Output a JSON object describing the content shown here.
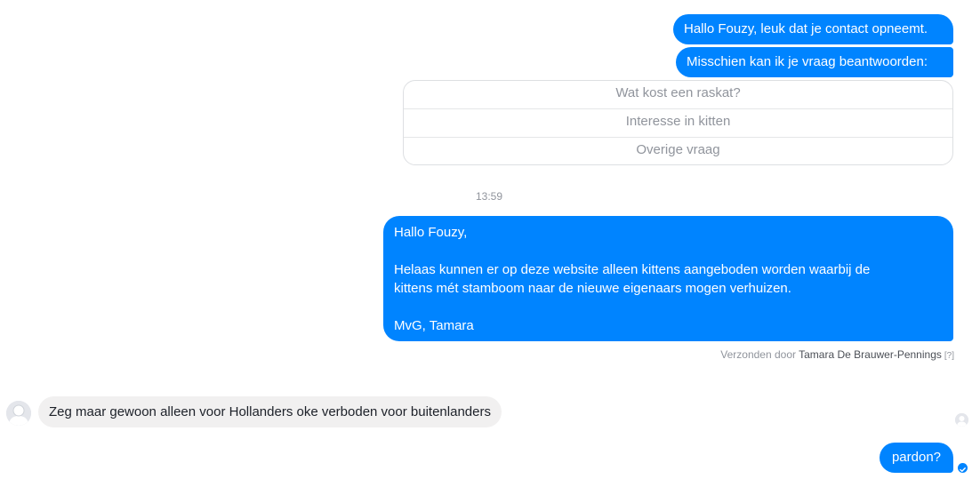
{
  "messages": {
    "greeting": "Hallo Fouzy, leuk dat je contact opneemt.",
    "question_intro": "Misschien kan ik je vraag beantwoorden:",
    "quick_replies": [
      "Wat kost een raskat?",
      "Interesse in kitten",
      "Overige vraag"
    ],
    "timestamp": "13:59",
    "reply": {
      "line1": "Hallo Fouzy,",
      "line2": "Helaas kunnen er op deze website alleen kittens aangeboden worden waarbij de",
      "line3": "kittens mét stamboom naar de nieuwe eigenaars mogen verhuizen.",
      "line4": "MvG, Tamara"
    },
    "sent_by": {
      "prefix": "Verzonden door",
      "author": "Tamara De Brauwer-Pennings",
      "help": "[?]"
    },
    "incoming": "Zeg maar gewoon alleen voor Hollanders oke verboden voor buitenlanders",
    "last_outgoing": "pardon?"
  },
  "colors": {
    "outgoing_bubble": "#0084ff",
    "incoming_bubble": "#f1f0f0",
    "muted_text": "#90949c"
  },
  "icons": {
    "incoming_avatar": "user-avatar-icon",
    "seen_avatar": "seen-avatar-icon",
    "delivered": "delivered-check-icon"
  }
}
